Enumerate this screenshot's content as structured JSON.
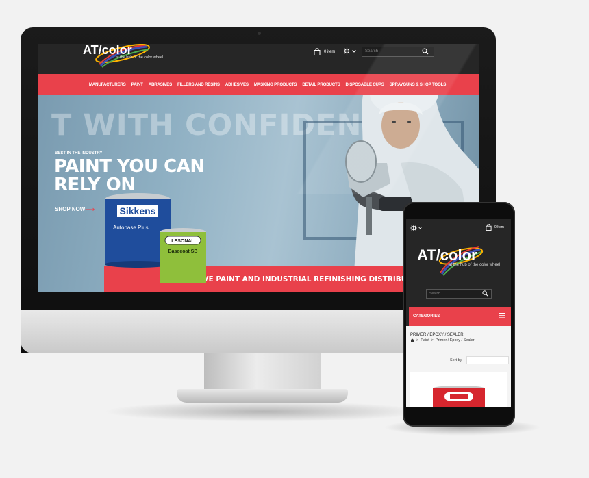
{
  "desktop": {
    "header": {
      "logo_text": "AT/color",
      "logo_tagline": "at the hub of the color wheel",
      "cart_count": "0 item",
      "search_placeholder": "Search"
    },
    "nav": {
      "items": [
        "MANUFACTURERS",
        "PAINT",
        "ABRASIVES",
        "FILLERS AND RESINS",
        "ADHESIVES",
        "MASKING PRODUCTS",
        "DETAIL PRODUCTS",
        "DISPOSABLE CUPS",
        "SPRAYGUNS & SHOP TOOLS"
      ]
    },
    "hero": {
      "background_text": "T WITH CONFIDENCE",
      "eyebrow": "BEST IN THE INDUSTRY",
      "title_line1": "PAINT YOU CAN",
      "title_line2": "RELY ON",
      "cta": "SHOP NOW",
      "banner": "AUTOMOTIVE PAINT AND INDUSTRIAL REFINISHING DISTRIBUTOR",
      "can1_brand": "Sikkens",
      "can1_product": "Autobase Plus",
      "can2_brand": "LESONAL",
      "can2_product": "Basecoat SB"
    }
  },
  "mobile": {
    "cart_count": "0 Item",
    "logo_text": "AT/color",
    "logo_tagline": "at the hub of the color wheel",
    "search_placeholder": "Search",
    "categories_label": "CATEGORIES",
    "page_title": "PRIMER / EPOXY / SEALER",
    "breadcrumb": {
      "sep": ">",
      "paint": "Paint",
      "current": "Primer / Epoxy / Sealer"
    },
    "sort_label": "Sort by",
    "sort_value": "–"
  },
  "colors": {
    "accent_red": "#e9414b",
    "header_dark": "#262626"
  }
}
